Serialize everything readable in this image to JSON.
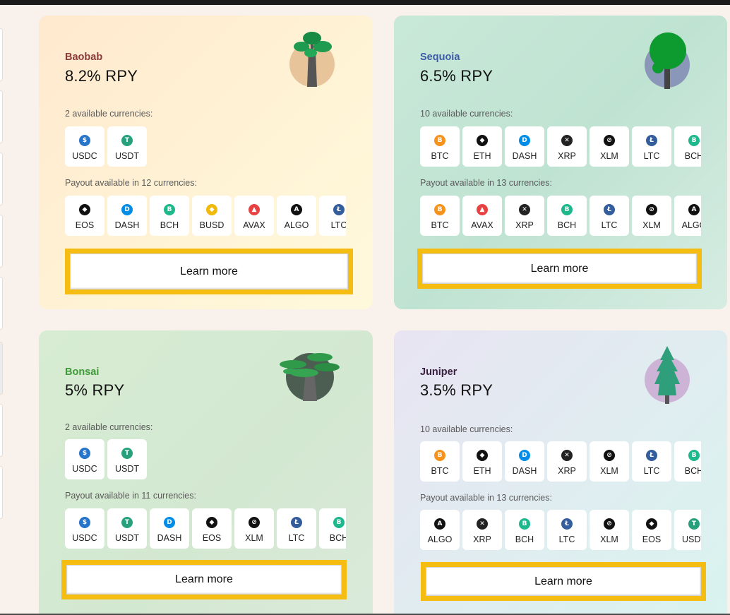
{
  "colors": {
    "highlight": "#f5bd12",
    "baobab_name": "#8b3a3a",
    "sequoia_name": "#3d5aa8",
    "bonsai_name": "#3f9a3a",
    "juniper_name": "#3a2040"
  },
  "coins": {
    "USDC": {
      "color": "#2775ca",
      "glyph": "$"
    },
    "USDT": {
      "color": "#26a17b",
      "glyph": "T"
    },
    "EOS": {
      "color": "#111111",
      "glyph": "◆"
    },
    "DASH": {
      "color": "#008ce7",
      "glyph": "D"
    },
    "BCH": {
      "color": "#1db88b",
      "glyph": "B"
    },
    "BUSD": {
      "color": "#f0b90b",
      "glyph": "◆"
    },
    "AVAX": {
      "color": "#e84142",
      "glyph": "▲"
    },
    "ALGO": {
      "color": "#111111",
      "glyph": "A"
    },
    "LTC": {
      "color": "#345d9d",
      "glyph": "Ł"
    },
    "BTC": {
      "color": "#f7931a",
      "glyph": "B"
    },
    "ETH": {
      "color": "#111111",
      "glyph": "◆"
    },
    "XRP": {
      "color": "#222222",
      "glyph": "✕"
    },
    "XLM": {
      "color": "#111111",
      "glyph": "⊘"
    }
  },
  "plans": [
    {
      "name": "Baobab",
      "rate": "8.2% RPY",
      "available_label": "2 available currencies:",
      "available": [
        "USDC",
        "USDT"
      ],
      "payout_label": "Payout available in 12 currencies:",
      "payout": [
        "EOS",
        "DASH",
        "BCH",
        "BUSD",
        "AVAX",
        "ALGO",
        "LTC"
      ],
      "button": "Learn more",
      "tree_icon": "baobab-tree-icon"
    },
    {
      "name": "Sequoia",
      "rate": "6.5% RPY",
      "available_label": "10 available currencies:",
      "available": [
        "BTC",
        "ETH",
        "DASH",
        "XRP",
        "XLM",
        "LTC",
        "BCH"
      ],
      "payout_label": "Payout available in 13 currencies:",
      "payout": [
        "BTC",
        "AVAX",
        "XRP",
        "BCH",
        "LTC",
        "XLM",
        "ALGO"
      ],
      "button": "Learn more",
      "tree_icon": "sequoia-tree-icon"
    },
    {
      "name": "Bonsai",
      "rate": "5% RPY",
      "available_label": "2 available currencies:",
      "available": [
        "USDC",
        "USDT"
      ],
      "payout_label": "Payout available in 11 currencies:",
      "payout": [
        "USDC",
        "USDT",
        "DASH",
        "EOS",
        "XLM",
        "LTC",
        "BCH"
      ],
      "button": "Learn more",
      "tree_icon": "bonsai-tree-icon"
    },
    {
      "name": "Juniper",
      "rate": "3.5% RPY",
      "available_label": "10 available currencies:",
      "available": [
        "BTC",
        "ETH",
        "DASH",
        "XRP",
        "XLM",
        "LTC",
        "BCH"
      ],
      "payout_label": "Payout available in 13 currencies:",
      "payout": [
        "ALGO",
        "XRP",
        "BCH",
        "LTC",
        "XLM",
        "EOS",
        "USDT"
      ],
      "button": "Learn more",
      "tree_icon": "juniper-tree-icon"
    }
  ]
}
